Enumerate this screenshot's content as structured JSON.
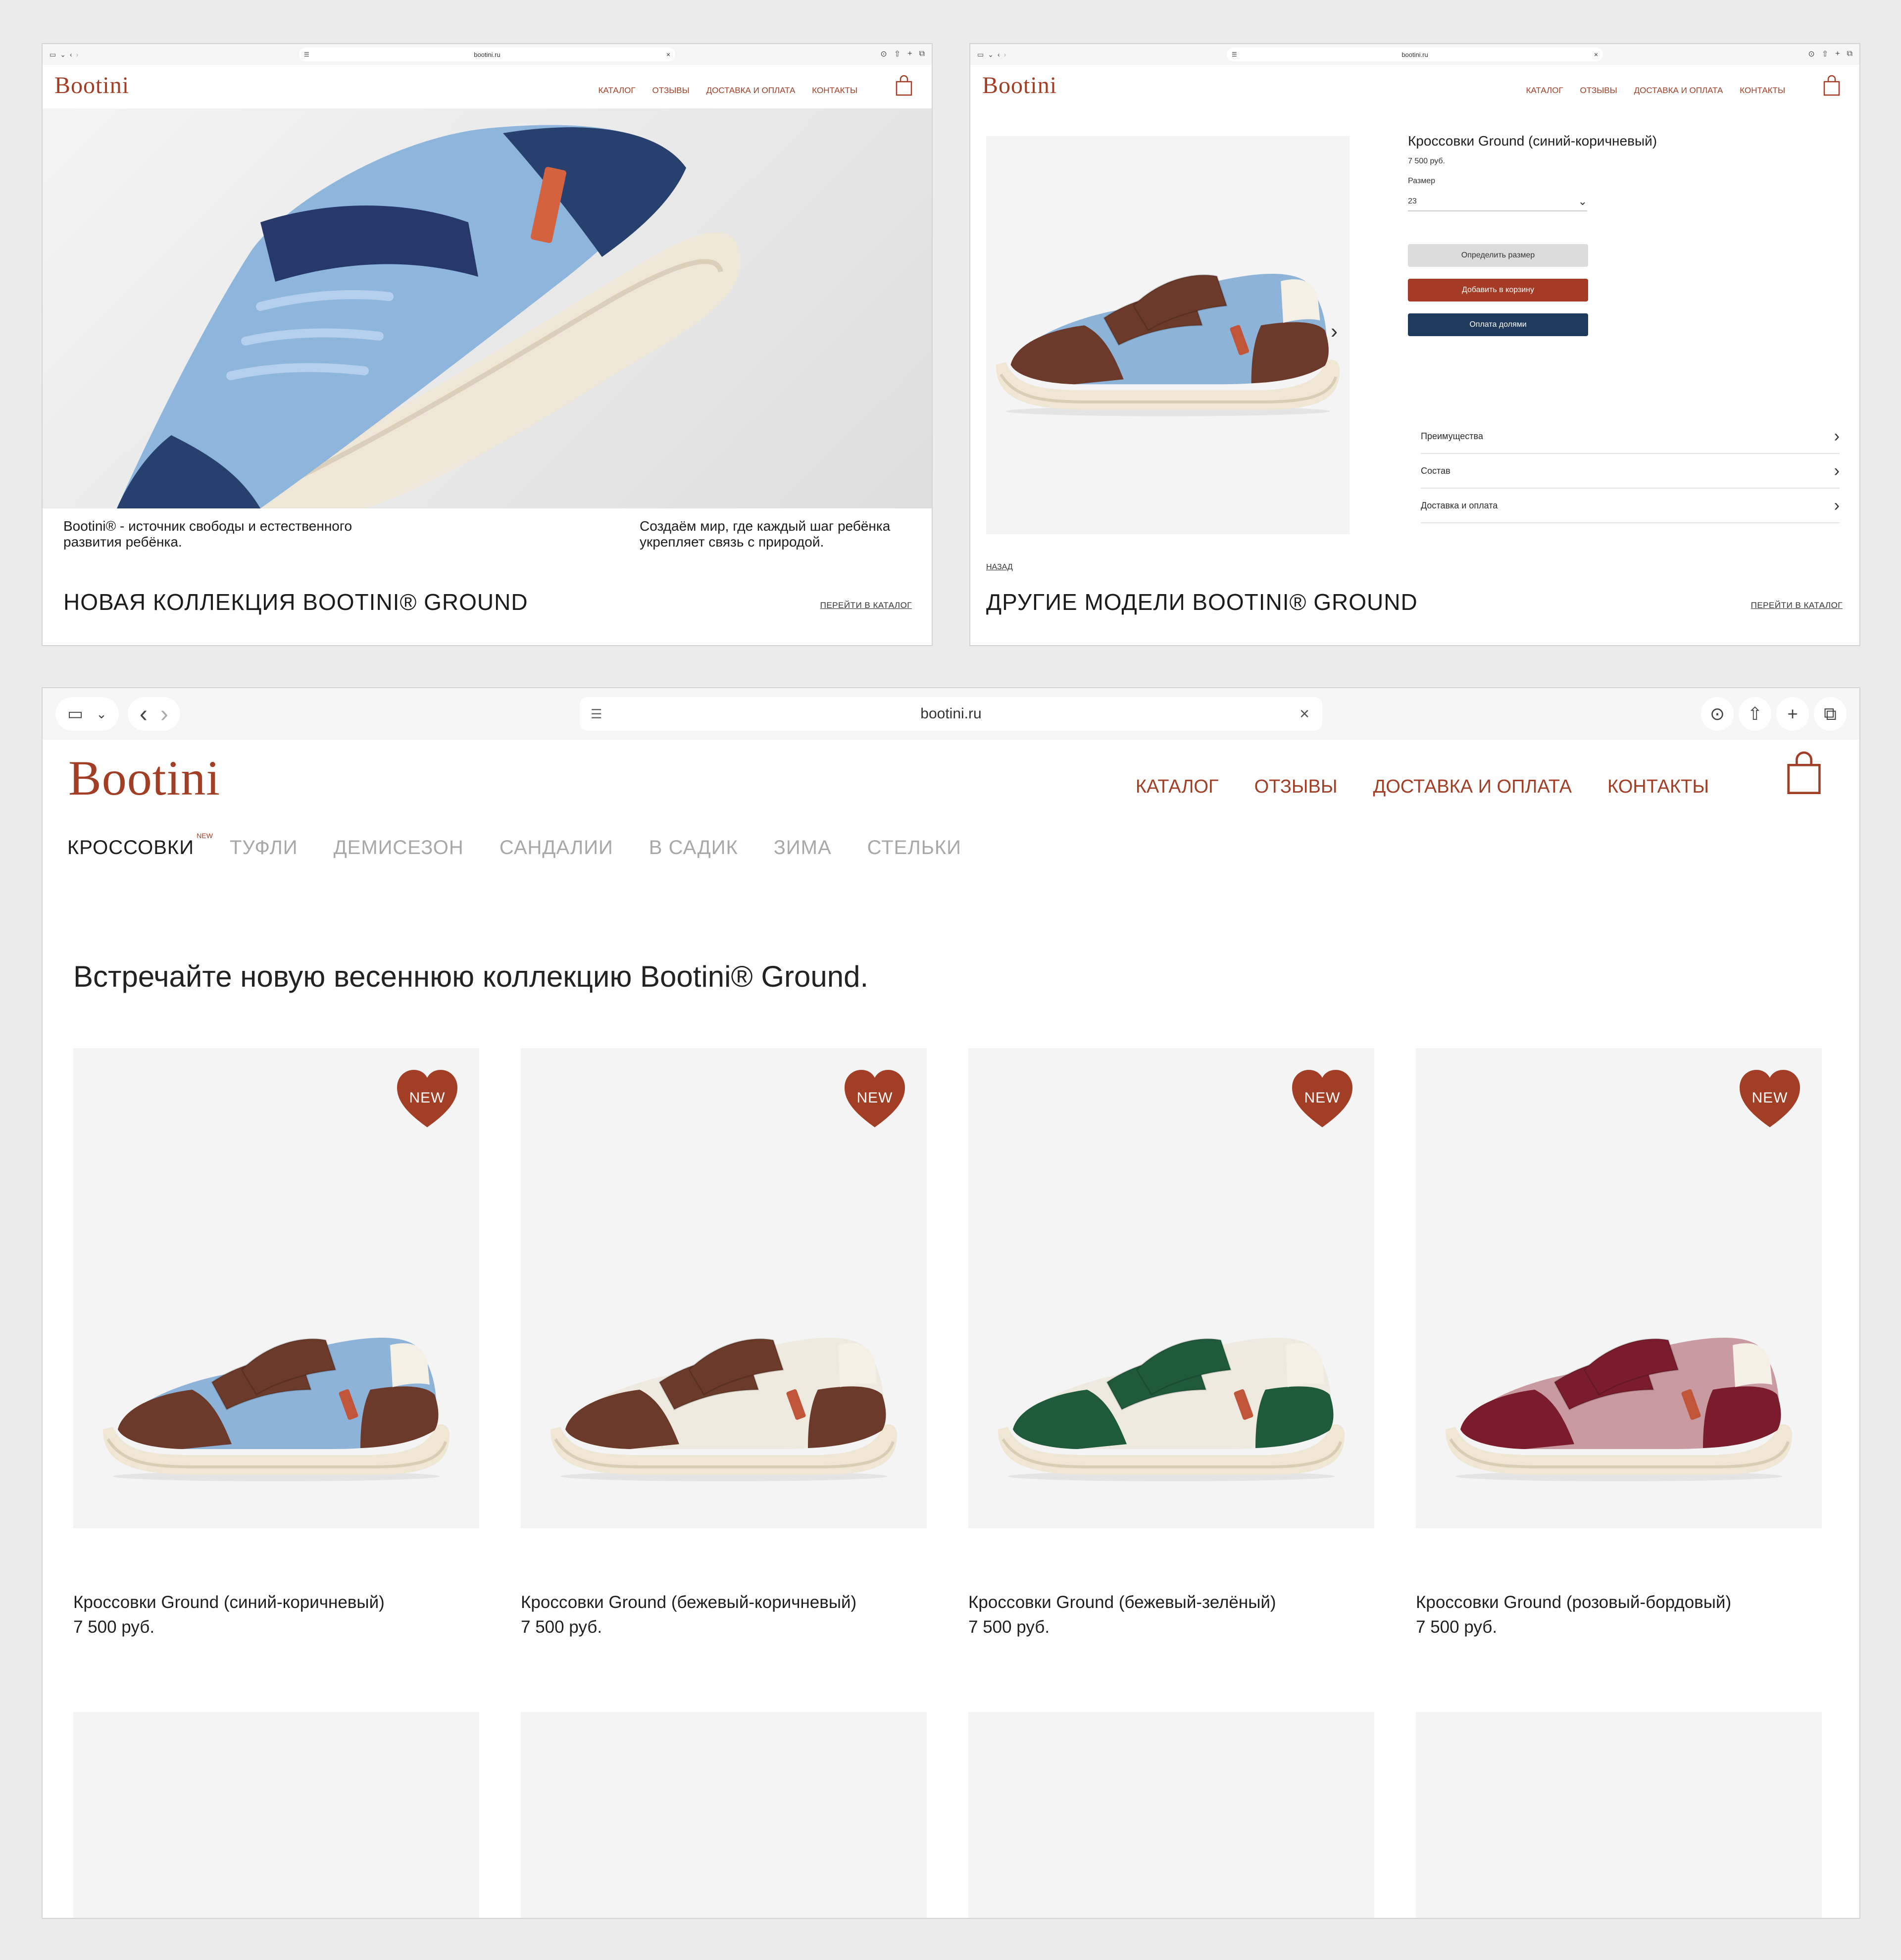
{
  "browser": {
    "url": "bootini.ru",
    "sidebar_icon": "sidebar-icon",
    "icons": [
      "download-icon",
      "share-icon",
      "plus-icon",
      "tabs-icon"
    ]
  },
  "site": {
    "logo": "Bootini",
    "nav": [
      "КАТАЛОГ",
      "ОТЗЫВЫ",
      "ДОСТАВКА И ОПЛАТА",
      "КОНТАКТЫ"
    ],
    "colors": {
      "brand": "#a23e25",
      "navy": "#1f3a5c",
      "grey_button": "#dcdcdc"
    }
  },
  "home": {
    "desc_left": "Bootini® - источник свободы и естественного развития ребёнка.",
    "desc_right": "Создаём мир, где каждый шаг ребёнка укрепляет связь с природой.",
    "collection_title": "НОВАЯ КОЛЛЕКЦИЯ BOOTINI® GROUND",
    "catalog_link": "ПЕРЕЙТИ В КАТАЛОГ"
  },
  "product": {
    "title": "Кроссовки Ground (синий-коричневый)",
    "price": "7 500 руб.",
    "size_label": "Размер",
    "size_value": "23",
    "btn_size": "Определить размер",
    "btn_cart": "Добавить в корзину",
    "btn_installments": "Оплата долями",
    "accordion": [
      "Преимущества",
      "Состав",
      "Доставка и оплата"
    ],
    "back": "НАЗАД",
    "other_title": "ДРУГИЕ МОДЕЛИ BOOTINI® GROUND",
    "catalog_link": "ПЕРЕЙТИ В КАТАЛОГ"
  },
  "catalog": {
    "categories": [
      "КРОССОВКИ",
      "ТУФЛИ",
      "ДЕМИСЕЗОН",
      "САНДАЛИИ",
      "В САДИК",
      "ЗИМА",
      "СТЕЛЬКИ"
    ],
    "new_label": "NEW",
    "headline": "Встречайте новую весеннюю коллекцию Bootini® Ground.",
    "badge": "NEW",
    "products": [
      {
        "name": "Кроссовки Ground (синий-коричневый)",
        "price": "7 500 руб.",
        "colors": [
          "#6b3a2a",
          "#8db3d9"
        ]
      },
      {
        "name": "Кроссовки Ground (бежевый-коричневый)",
        "price": "7 500 руб.",
        "colors": [
          "#6b3a2a",
          "#eeeae0"
        ]
      },
      {
        "name": "Кроссовки Ground (бежевый-зелёный)",
        "price": "7 500 руб.",
        "colors": [
          "#1f5a3a",
          "#eeeae0"
        ]
      },
      {
        "name": "Кроссовки Ground (розовый-бордовый)",
        "price": "7 500 руб.",
        "colors": [
          "#7a1c2b",
          "#c99aa0"
        ]
      }
    ]
  }
}
